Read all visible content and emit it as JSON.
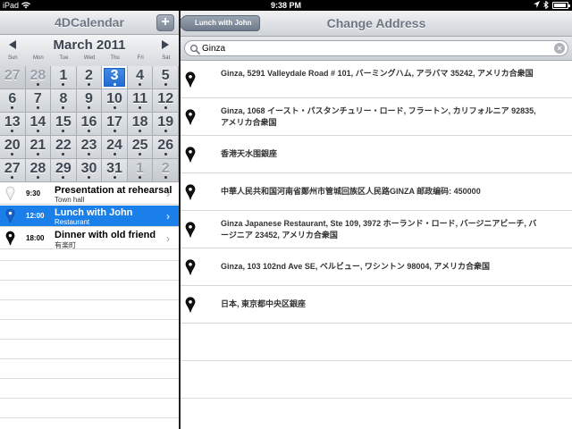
{
  "status": {
    "device": "iPad",
    "time": "9:38 PM"
  },
  "left": {
    "title": "4DCalendar",
    "add_label": "+",
    "month": "March 2011",
    "weekdays": [
      "Sun",
      "Mon",
      "Tue",
      "Wed",
      "Thu",
      "Fri",
      "Sat"
    ],
    "weeks": [
      [
        {
          "d": "27",
          "other": true,
          "dot": false
        },
        {
          "d": "28",
          "other": true,
          "dot": true
        },
        {
          "d": "1",
          "other": false,
          "dot": true
        },
        {
          "d": "2",
          "other": false,
          "dot": true
        },
        {
          "d": "3",
          "other": false,
          "dot": true,
          "today": true
        },
        {
          "d": "4",
          "other": false,
          "dot": true
        },
        {
          "d": "5",
          "other": false,
          "dot": true
        }
      ],
      [
        {
          "d": "6",
          "other": false,
          "dot": true
        },
        {
          "d": "7",
          "other": false,
          "dot": true
        },
        {
          "d": "8",
          "other": false,
          "dot": true
        },
        {
          "d": "9",
          "other": false,
          "dot": true
        },
        {
          "d": "10",
          "other": false,
          "dot": true
        },
        {
          "d": "11",
          "other": false,
          "dot": true
        },
        {
          "d": "12",
          "other": false,
          "dot": true
        }
      ],
      [
        {
          "d": "13",
          "other": false,
          "dot": true
        },
        {
          "d": "14",
          "other": false,
          "dot": true
        },
        {
          "d": "15",
          "other": false,
          "dot": true
        },
        {
          "d": "16",
          "other": false,
          "dot": true
        },
        {
          "d": "17",
          "other": false,
          "dot": true
        },
        {
          "d": "18",
          "other": false,
          "dot": true
        },
        {
          "d": "19",
          "other": false,
          "dot": true
        }
      ],
      [
        {
          "d": "20",
          "other": false,
          "dot": true
        },
        {
          "d": "21",
          "other": false,
          "dot": true
        },
        {
          "d": "22",
          "other": false,
          "dot": true
        },
        {
          "d": "23",
          "other": false,
          "dot": true
        },
        {
          "d": "24",
          "other": false,
          "dot": true
        },
        {
          "d": "25",
          "other": false,
          "dot": true
        },
        {
          "d": "26",
          "other": false,
          "dot": true
        }
      ],
      [
        {
          "d": "27",
          "other": false,
          "dot": true
        },
        {
          "d": "28",
          "other": false,
          "dot": true
        },
        {
          "d": "29",
          "other": false,
          "dot": true
        },
        {
          "d": "30",
          "other": false,
          "dot": true
        },
        {
          "d": "31",
          "other": false,
          "dot": true
        },
        {
          "d": "1",
          "other": true,
          "dot": true
        },
        {
          "d": "2",
          "other": true,
          "dot": true
        }
      ]
    ],
    "events": [
      {
        "time": "9:30",
        "title": "Presentation at rehearsal",
        "subtitle": "Town hall",
        "pin": "white-pin-icon",
        "selected": false
      },
      {
        "time": "12:00",
        "title": "Lunch with John",
        "subtitle": "Restaurant",
        "pin": "blue-pin-icon",
        "selected": true
      },
      {
        "time": "18:00",
        "title": "Dinner with old friend",
        "subtitle": "有楽町",
        "pin": "black-pin-icon",
        "selected": false
      }
    ]
  },
  "right": {
    "back_label": "Lunch with John",
    "title": "Change Address",
    "search": {
      "value": "Ginza",
      "placeholder": ""
    },
    "results": [
      "Ginza, 5291 Valleydale Road # 101, バーミングハム, アラバマ 35242, アメリカ合衆国",
      "Ginza, 1068 イースト・パスタンチュリー・ロード, フラートン, カリフォルニア 92835, アメリカ合衆国",
      "香港天水围銀座",
      "中華人民共和国河南省鄭州市管城回族区人民路GINZA 邮政编码: 450000",
      "Ginza Japanese Restaurant, Ste 109, 3972 ホーランド・ロード, バージニアビーチ, バージニア 23452, アメリカ合衆国",
      "Ginza, 103 102nd Ave SE, ベルビュー, ワシントン 98004, アメリカ合衆国",
      "日本, 東京都中央区銀座"
    ]
  },
  "colors": {
    "selection": "#1a7fe8",
    "today": "#1c68cf"
  }
}
